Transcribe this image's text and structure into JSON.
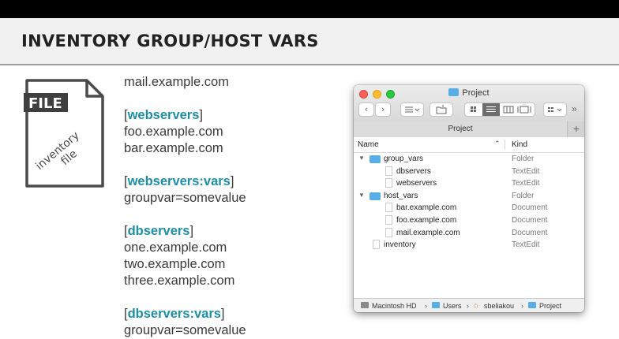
{
  "slide": {
    "title": "INVENTORY GROUP/HOST VARS"
  },
  "file_icon": {
    "label": "FILE",
    "caption_line1": "inventory",
    "caption_line2": "file"
  },
  "inventory_lines": [
    "mail.example.com",
    "",
    {
      "group": "webservers"
    },
    "foo.example.com",
    "bar.example.com",
    "",
    {
      "group": "webservers:vars"
    },
    "groupvar=somevalue",
    "",
    {
      "group": "dbservers"
    },
    "one.example.com",
    "two.example.com",
    "three.example.com",
    "",
    {
      "group": "dbservers:vars"
    },
    "groupvar=somevalue"
  ],
  "finder": {
    "window_title": "Project",
    "tab_label": "Project",
    "tab_add": "+",
    "columns": {
      "name": "Name",
      "kind": "Kind"
    },
    "toolbar": {
      "back": "‹",
      "forward": "›",
      "more": "»"
    },
    "rows": [
      {
        "name": "group_vars",
        "kind": "Folder",
        "type": "folder",
        "depth": 0,
        "expanded": true
      },
      {
        "name": "dbservers",
        "kind": "TextEdit",
        "type": "doc",
        "depth": 1
      },
      {
        "name": "webservers",
        "kind": "TextEdit",
        "type": "doc",
        "depth": 1
      },
      {
        "name": "host_vars",
        "kind": "Folder",
        "type": "folder",
        "depth": 0,
        "expanded": true
      },
      {
        "name": "bar.example.com",
        "kind": "Document",
        "type": "doc",
        "depth": 1
      },
      {
        "name": "foo.example.com",
        "kind": "Document",
        "type": "doc",
        "depth": 1
      },
      {
        "name": "mail.example.com",
        "kind": "Document",
        "type": "doc",
        "depth": 1
      },
      {
        "name": "inventory",
        "kind": "TextEdit",
        "type": "doc",
        "depth": 0
      }
    ],
    "path": [
      "Macintosh HD",
      "Users",
      "sbeliakou",
      "Project"
    ]
  },
  "colors": {
    "group_accent": "#1c8fa6",
    "folder_blue": "#5aaee8"
  }
}
